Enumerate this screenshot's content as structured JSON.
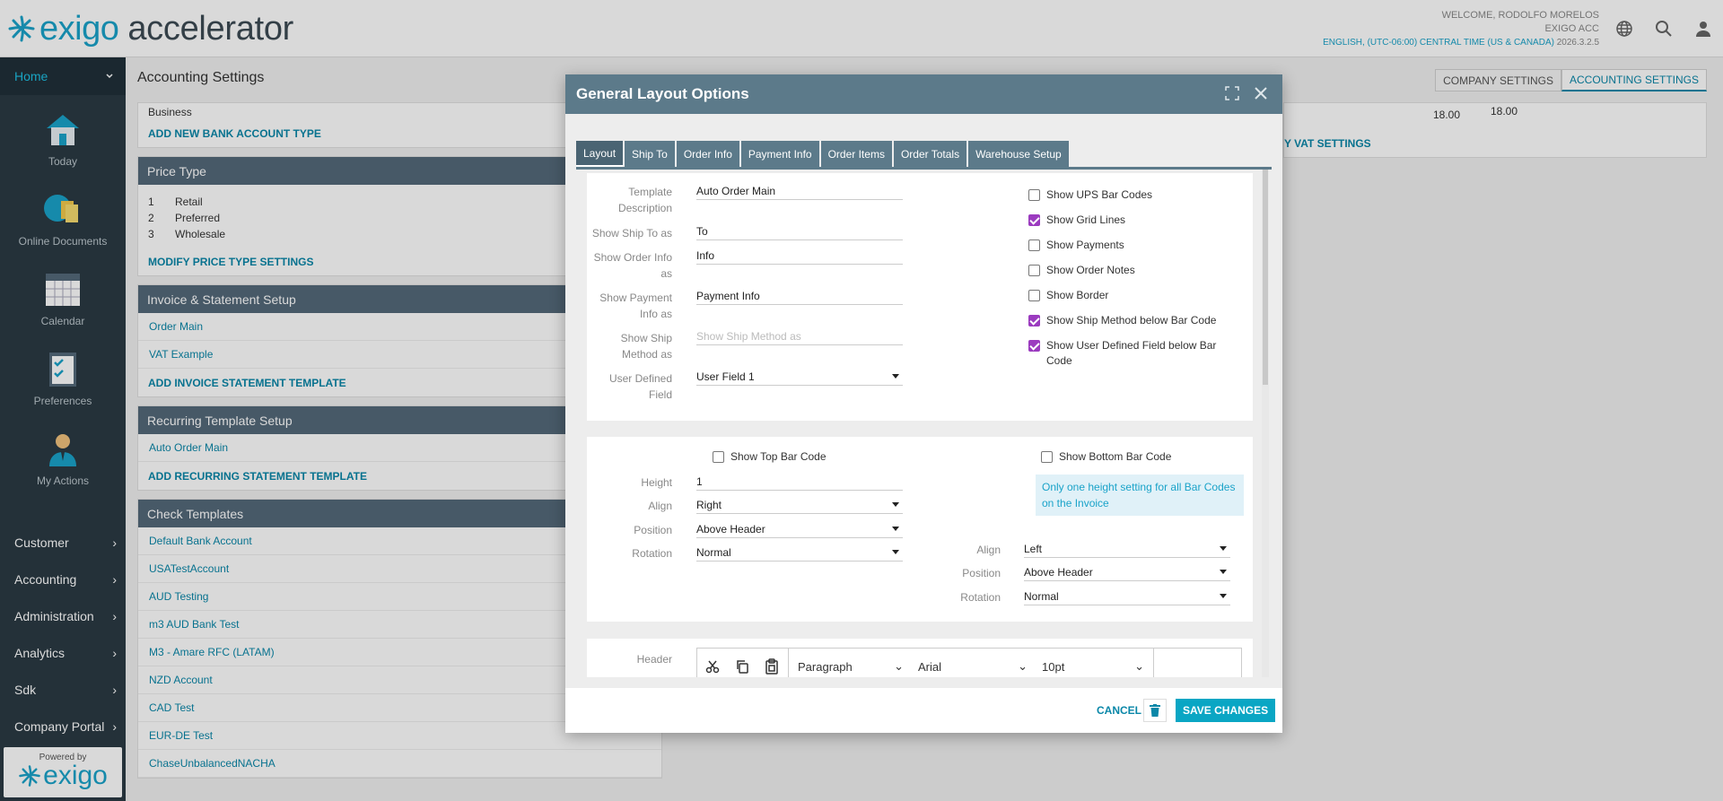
{
  "header": {
    "brand_main": "exigo",
    "brand_sub": "accelerator",
    "welcome": "WELCOME, RODOLFO MORELOS",
    "account": "EXIGO ACC",
    "locale": "ENGLISH, (UTC-06:00) CENTRAL TIME (US & CANADA)",
    "version": "2026.3.2.5",
    "icons": [
      "globe-icon",
      "search-icon",
      "user-icon"
    ]
  },
  "sidebar": {
    "home": "Home",
    "tiles": [
      {
        "label": "Today",
        "icon": "house-icon"
      },
      {
        "label": "Online Documents",
        "icon": "documents-icon"
      },
      {
        "label": "Calendar",
        "icon": "calendar-icon"
      },
      {
        "label": "Preferences",
        "icon": "checklist-icon"
      },
      {
        "label": "My Actions",
        "icon": "person-icon"
      }
    ],
    "menu": [
      "Customer",
      "Accounting",
      "Administration",
      "Analytics",
      "Sdk",
      "Company Portal"
    ],
    "powered_by": "Powered by",
    "powered_logo": "exigo"
  },
  "page": {
    "title": "Accounting Settings",
    "tabs": [
      "COMPANY SETTINGS",
      "ACCOUNTING SETTINGS"
    ],
    "bank_account_type_row": "Business",
    "add_bank_account_type": "ADD NEW BANK ACCOUNT TYPE",
    "price_type": {
      "title": "Price Type",
      "rows": [
        {
          "num": "1",
          "name": "Retail"
        },
        {
          "num": "2",
          "name": "Preferred"
        },
        {
          "num": "3",
          "name": "Wholesale"
        }
      ],
      "link": "MODIFY PRICE TYPE SETTINGS"
    },
    "invoice": {
      "title": "Invoice & Statement Setup",
      "rows": [
        "Order Main",
        "VAT Example"
      ],
      "link": "ADD INVOICE STATEMENT TEMPLATE"
    },
    "recurring": {
      "title": "Recurring Template Setup",
      "rows": [
        "Auto Order Main"
      ],
      "link": "ADD RECURRING STATEMENT TEMPLATE"
    },
    "check": {
      "title": "Check Templates",
      "rows": [
        "Default Bank Account",
        "USATestAccount",
        "AUD Testing",
        "m3 AUD Bank Test",
        "M3 - Amare RFC (LATAM)",
        "NZD Account",
        "CAD Test",
        "EUR-DE Test",
        "ChaseUnbalancedNACHA"
      ]
    },
    "vat": {
      "val1": "18.00",
      "val2": "18.00",
      "link": "Y VAT SETTINGS"
    }
  },
  "modal": {
    "title": "General Layout Options",
    "tabs": [
      "Layout",
      "Ship To",
      "Order Info",
      "Payment Info",
      "Order Items",
      "Order Totals",
      "Warehouse Setup"
    ],
    "fields": [
      {
        "label": "Template Description",
        "value": "Auto Order Main"
      },
      {
        "label": "Show Ship To as",
        "value": "To"
      },
      {
        "label": "Show Order Info as",
        "value": "Info"
      },
      {
        "label": "Show Payment Info as",
        "value": "Payment Info"
      },
      {
        "label": "Show Ship Method as",
        "placeholder": "Show Ship Method as"
      },
      {
        "label": "User Defined Field",
        "value": "User Field 1"
      }
    ],
    "checks": [
      {
        "label": "Show UPS Bar Codes",
        "checked": false
      },
      {
        "label": "Show Grid Lines",
        "checked": true
      },
      {
        "label": "Show Payments",
        "checked": false
      },
      {
        "label": "Show Order Notes",
        "checked": false
      },
      {
        "label": "Show Border",
        "checked": false
      },
      {
        "label": "Show Ship Method below Bar Code",
        "checked": true
      },
      {
        "label": "Show User Defined Field below Bar Code",
        "checked": true
      }
    ],
    "barcode": {
      "top_label": "Show Top Bar Code",
      "bottom_label": "Show Bottom Bar Code",
      "info": "Only one height setting for all Bar Codes on the Invoice",
      "height_label": "Height",
      "height": "1",
      "align_label": "Align",
      "position_label": "Position",
      "rotation_label": "Rotation",
      "top_align": "Right",
      "top_position": "Above Header",
      "top_rotation": "Normal",
      "bottom_align": "Left",
      "bottom_position": "Above Header",
      "bottom_rotation": "Normal"
    },
    "editor": {
      "label": "Header",
      "format": "Paragraph",
      "font": "Arial",
      "size": "10pt"
    },
    "footer": {
      "cancel": "CANCEL",
      "save": "SAVE CHANGES"
    }
  },
  "colors": {
    "accent": "#1aa3c9",
    "sidebar": "#2b3a44",
    "panel_header": "#54697a",
    "modal_header": "#5c7a8a",
    "checkbox": "#9b3bbf"
  }
}
